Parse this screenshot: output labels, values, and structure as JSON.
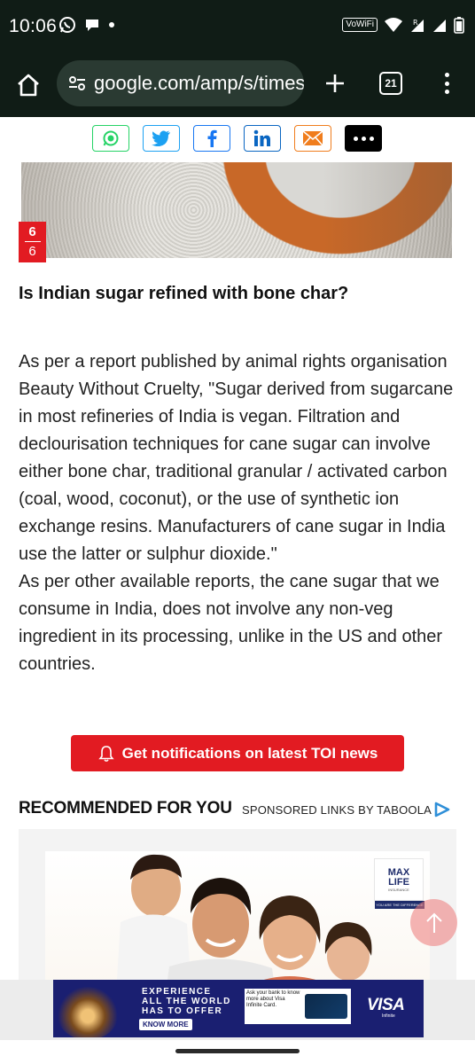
{
  "status_bar": {
    "time": "10:06",
    "vowifi": "VoWiFi",
    "roaming": "R"
  },
  "browser": {
    "url": "google.com/amp/s/times",
    "tab_count": "21"
  },
  "share": {
    "items": [
      "whatsapp-icon",
      "twitter-icon",
      "facebook-icon",
      "linkedin-icon",
      "email-icon",
      "more-icon"
    ],
    "colors": {
      "whatsapp": "#25d366",
      "twitter": "#1da1f2",
      "facebook": "#1877f2",
      "linkedin": "#0a66c2",
      "email": "#f07d1d",
      "more": "#000000"
    }
  },
  "slide": {
    "current": "6",
    "total": "6"
  },
  "article": {
    "heading": "Is Indian sugar refined with bone char?",
    "paragraph_1": "As per a report published by animal rights organisation Beauty Without Cruelty, \"Sugar derived from sugarcane in most refineries of India is vegan. Filtration and declourisation techniques for cane sugar can involve either bone char, traditional granular / activated carbon (coal, wood, coconut), or the use of synthetic ion exchange resins. Manufacturers of cane sugar in India use the latter or sulphur dioxide.\"",
    "paragraph_2": "As per other available reports, the cane sugar that we consume in India, does not involve any non-veg ingredient in its processing, unlike in the US and other countries."
  },
  "notification": {
    "label": "Get notifications on latest TOI news"
  },
  "recommended": {
    "title": "RECOMMENDED FOR YOU",
    "sponsored": "SPONSORED LINKS BY TABOOLA",
    "ad": {
      "brand_line1": "MAX",
      "brand_line2": "LIFE",
      "brand_sub": "INSURANCE",
      "tagline": "YOU ARE THE DIFFERENCE"
    }
  },
  "banner_ad": {
    "headline_1": "EXPERIENCE",
    "headline_2": "ALL THE WORLD",
    "headline_3": "HAS TO OFFER",
    "cta": "KNOW MORE",
    "card_text": "Ask your bank to know more about Visa Infinite Card.",
    "brand": "VISA",
    "brand_sub": "Infinite"
  },
  "theme": {
    "accent": "#e21b22",
    "toolbar_bg": "#101c16"
  }
}
